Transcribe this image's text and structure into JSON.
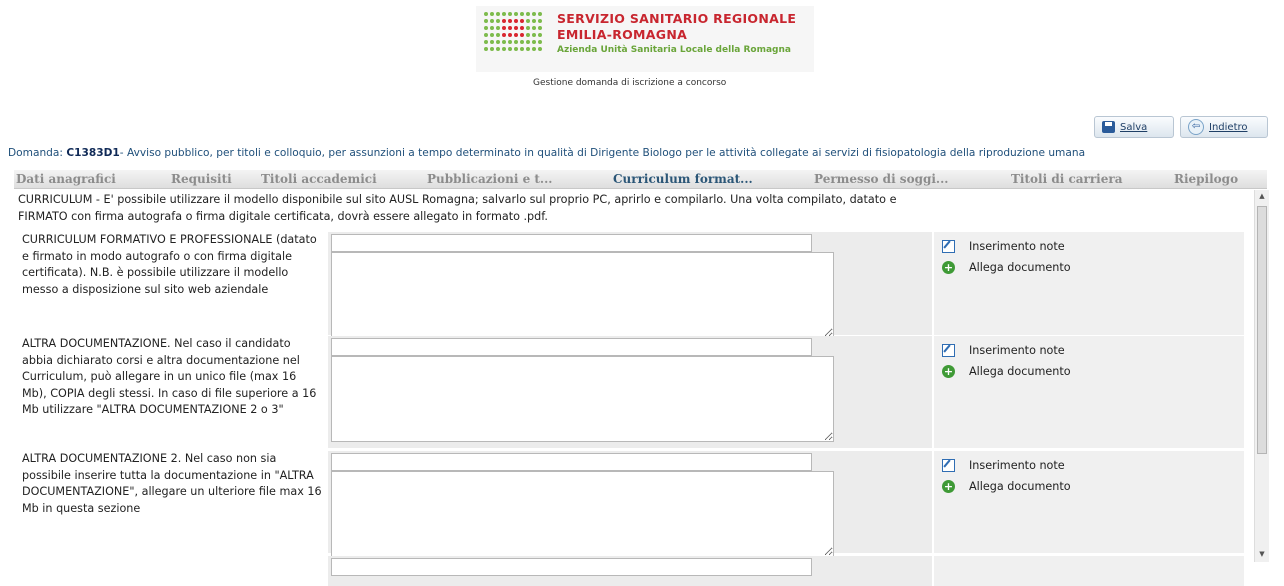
{
  "header": {
    "logo_line1": "SERVIZIO SANITARIO REGIONALE",
    "logo_line2": "EMILIA-ROMAGNA",
    "logo_line3": "Azienda Unità Sanitaria Locale della Romagna",
    "subtitle": "Gestione domanda di iscrizione a concorso"
  },
  "toolbar": {
    "save_label": "Salva",
    "back_label": "Indietro"
  },
  "domanda": {
    "prefix": "Domanda: ",
    "code": "C1383D1",
    "text": "- Avviso pubblico, per titoli e colloquio, per assunzioni a tempo determinato in qualità di Dirigente Biologo per le attività collegate ai servizi di fisiopatologia della riproduzione umana"
  },
  "tabs": [
    {
      "label": "Dati anagrafici"
    },
    {
      "label": "Requisiti"
    },
    {
      "label": "Titoli accademici"
    },
    {
      "label": "Pubblicazioni e t..."
    },
    {
      "label": "Curriculum format..."
    },
    {
      "label": "Permesso di soggi..."
    },
    {
      "label": "Titoli di carriera"
    },
    {
      "label": "Riepilogo"
    }
  ],
  "active_tab": "Curriculum format...",
  "intro": "CURRICULUM - E' possibile utilizzare il modello disponibile sul sito AUSL Romagna; salvarlo sul proprio PC, aprirlo e compilarlo. Una volta compilato, datato e FIRMATO con firma autografa o firma digitale certificata, dovrà essere allegato in formato .pdf.",
  "sections": [
    {
      "label": "CURRICULUM FORMATIVO E PROFESSIONALE (datato e firmato in modo autografo o con firma digitale certificata). N.B. è possibile utilizzare il modello messo a disposizione sul sito web aziendale",
      "input_value": "",
      "textarea_value": "",
      "note_label": "Inserimento note",
      "attach_label": "Allega documento"
    },
    {
      "label": "ALTRA DOCUMENTAZIONE. Nel caso il candidato abbia dichiarato corsi e altra documentazione nel Curriculum, può allegare in un unico file (max 16 Mb), COPIA degli stessi. In caso di file superiore a 16 Mb utilizzare \"ALTRA DOCUMENTAZIONE 2 o 3\"",
      "input_value": "",
      "textarea_value": "",
      "note_label": "Inserimento note",
      "attach_label": "Allega documento"
    },
    {
      "label": "ALTRA DOCUMENTAZIONE 2. Nel caso non sia possibile inserire tutta la documentazione in \"ALTRA DOCUMENTAZIONE\", allegare un ulteriore file max 16 Mb in questa sezione",
      "input_value": "",
      "textarea_value": "",
      "note_label": "Inserimento note",
      "attach_label": "Allega documento"
    }
  ],
  "colors": {
    "brand_red": "#c8262f",
    "brand_green": "#6aa53a",
    "tab_active": "#2b5677",
    "domanda_blue": "#1f4f7a"
  }
}
